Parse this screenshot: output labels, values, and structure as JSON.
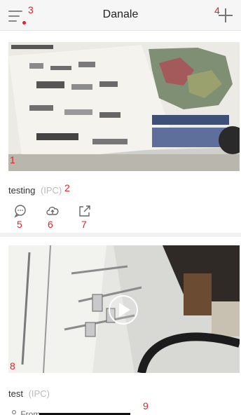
{
  "header": {
    "title": "Danale",
    "menu_icon": "menu-icon",
    "add_icon": "plus-icon"
  },
  "annotations": [
    "1",
    "2",
    "3",
    "4",
    "5",
    "6",
    "7",
    "8",
    "9"
  ],
  "devices": [
    {
      "name": "testing",
      "type": "(IPC)",
      "actions": [
        "message-icon",
        "cloud-upload-icon",
        "share-icon"
      ]
    },
    {
      "name": "test",
      "type": "(IPC)",
      "shared_from": "From"
    }
  ],
  "colors": {
    "accent_red": "#e0242b",
    "muted": "#bbbbbb",
    "bar": "#f6f6f6"
  }
}
